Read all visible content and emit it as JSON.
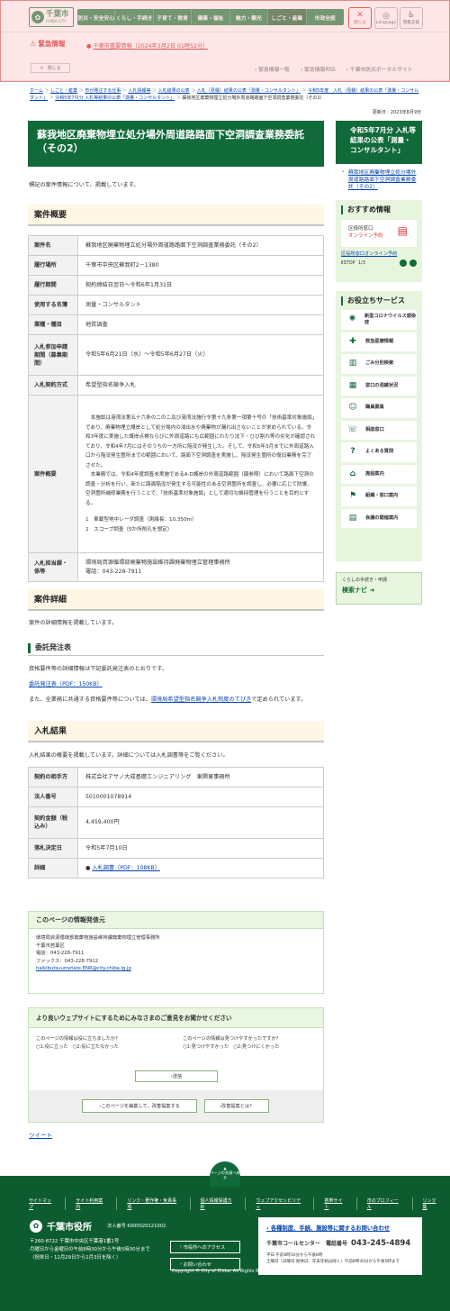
{
  "header": {
    "logo_title": "千葉市",
    "logo_sub": "CHIBA CITY",
    "nav": [
      "防災・安全安心",
      "くらし・手続き",
      "子育て・教育",
      "健康・福祉",
      "魅力・観光",
      "しごと・産業",
      "市政全般"
    ],
    "close_label": "閉じる",
    "language_label": "Language",
    "support_label": "閲覧支援"
  },
  "emergency": {
    "label": "緊急情報",
    "close_label": "閉じる",
    "news": "千葉市重要情報（2024年3月2日 01時52分）",
    "links": [
      "緊急情報一覧",
      "緊急情報RSS",
      "千葉市防災ポータルサイト"
    ]
  },
  "breadcrumb": [
    "ホーム",
    "しごと・産業",
    "市が発注する仕事",
    "入札情報等",
    "入札結果の公表",
    "入札（見積）結果の公表「測量・コンサルタント」",
    "令和5年度　入札（見積）結果の公表「測量・コンサルタント」",
    "令和5年7月分 入札等結果の公表「測量・コンサルタント」",
    "蘇我地区廃棄物埋立処分場外周道路路面下空洞調査業務委託（その2）"
  ],
  "updated": "更新日：2023年8月9日",
  "page_title": "蘇我地区廃棄物埋立処分場外周道路路面下空洞調査業務委託（その2）",
  "intro": "標記の案件情報について、掲載しています。",
  "overview": {
    "heading": "案件概要",
    "rows": [
      {
        "h": "案件名",
        "v": "蘇我地区廃棄物埋立処分場外周道路路面下空洞調査業務委託（その2）"
      },
      {
        "h": "履行場所",
        "v": "千葉市中央区蘇我町2－1380"
      },
      {
        "h": "履行期間",
        "v": "契約締結日翌日～令和6年1月31日"
      },
      {
        "h": "使用する名簿",
        "v": "測量・コンサルタント"
      },
      {
        "h": "業種・種目",
        "v": "地質調査"
      },
      {
        "h": "入札参加申請期間（募集期間）",
        "v": "令和5年6月21日（水）～令和5年6月27日（火）"
      },
      {
        "h": "入札契約方式",
        "v": "希望型指名競争入札"
      }
    ],
    "summary_head": "案件概要",
    "summary_p1": "　本施設は港湾法第五十六条のニのニ及び港湾法施行令第十九条第一項第十号の「技術基準対象施設」であり、廃棄物埋立護岸として処分場内の浸出水や廃棄物が漏れ出さないことが求められている。令和3年度に実施した護岸点検ならびに外周道路にも広範囲にわたり沈下・ひび割れ等の劣化が確認されており、令和4年7月にはそのうちの一方所に陥没が発生した。そして、令和5年3月までに外周道路入口から陥没発生箇所までの範囲において、路面下空洞調査を実施し、陥没発生箇所の復旧業務を完了させた。",
    "summary_p2": "　本業務では、令和4年度調査未実施であるA-D護岸の外周道路範囲（図参照）において路面下空洞の調査・分析を行い、新たに路面陥没が発生する可能性のある空洞箇所を調査し、必要に応じて防護、空洞箇所補修業務を行うことで、「技術基準対象施設」として適切な維持管理を行うことを目的とする。",
    "summary_l1": "1　車載型地中レーダ調査（測線長：10,350m）",
    "summary_l2": "2　スコープ調査（5か所削孔を想定）",
    "dept_head": "入札担当課・係等",
    "dept_v1": "環境局資源循環部廃棄物施設維持課廃棄物埋立管理事務所",
    "dept_v2": "電話：043-228-7911"
  },
  "details": {
    "heading": "案件詳細",
    "text": "案件の詳細情報を掲載しています。",
    "sub_heading": "委託発注表",
    "p1": "資格要件等の詳細情報は下記委託発注表のとおりです。",
    "link1": "委託発注表（PDF：150KB）",
    "p2a": "また、全業務に共通する資格要件等については、",
    "p2link": "環境局希望型指名競争入札制度のてびき",
    "p2b": "で定められています。"
  },
  "results": {
    "heading": "入札結果",
    "text": "入札結果の概要を掲載しています。詳細については入札調書等をご覧ください。",
    "rows": [
      {
        "h": "契約の相手方",
        "v": "株式会社アサノ大成基礎エンジニアリング　東関東事務所"
      },
      {
        "h": "法人番号",
        "v": "5010001078914"
      },
      {
        "h": "契約金額（税込み）",
        "v": "4,459,400円"
      },
      {
        "h": "落札決定日",
        "v": "令和5年7月10日"
      }
    ],
    "detail_head": "詳細",
    "detail_link": "入札調書（PDF：108KB）"
  },
  "info": {
    "heading": "このページの情報発信元",
    "lines": [
      "環境局資源循環部廃棄物施設維持課廃棄物埋立管理事務所",
      "千葉市若葉区",
      "電話：043-228-7911",
      "ファックス：043-228-7912"
    ],
    "email": "haikibutsuumetate.ENR@city.chiba.lg.jp"
  },
  "feedback": {
    "heading": "より良いウェブサイトにするためにみなさまのご意見をお聞かせください",
    "q1": "このページの情報は役に立ちましたか？",
    "q1a": "1:役に立った",
    "q1b": "2:役に立たなかった",
    "q2": "このページの情報は見つけやすかったですか？",
    "q2a": "1:見つけやすかった",
    "q2b": "2:見つけにくかった",
    "send": "送信",
    "btn1": "このページを編集して、改善提案する",
    "btn2": "改善提案とは？"
  },
  "tweet": "ツイート",
  "sidebar": {
    "month_title": "令和5年7月分 入札等結果の公表「測量・コンサルタント」",
    "month_link": "蘇我地区廃棄物埋立処分場外周道路路面下空洞調査業務委託（その2）",
    "recommend": "おすすめ情報",
    "card_l1": "区役所窓口",
    "card_l2": "オンライン予約",
    "card_caption": "区役所窓口オンライン予約",
    "stop": "STOP",
    "count": "1/3",
    "useful": "お役立ちサービス",
    "services": [
      "新型コロナウイルス感染症",
      "救急医療情報",
      "ごみ分別検索",
      "窓口の混雑状況",
      "職員募集",
      "相談窓口",
      "よくある質問",
      "施設案内",
      "組織・窓口案内",
      "会議の開催案内"
    ],
    "navi_a": "くらしの手続き・申請",
    "navi_b": "検索ナビ"
  },
  "footer": {
    "pagetop": "ページの先頭へ戻る",
    "links": [
      "サイトマップ",
      "サイト利用案内",
      "リンク・著作権・免責事項",
      "個人情報保護方針",
      "ウェブアクセシビリティ",
      "携帯サイト",
      "市のプロフィール",
      "リンク集"
    ],
    "name": "千葉市役所",
    "corp": "法人番号 6000020121002",
    "addr1": "〒260-8722 千葉市中央区千葉港1番1号",
    "addr2": "月曜日から金曜日の午前8時30分から午後5時30分まで",
    "addr3": "（祝休日・12月29日から1月3日を除く）",
    "access": "市役所へのアクセス",
    "contact": "お問い合わせ",
    "call_title": "各種制度、手続、施設等に関するお問い合わせ",
    "call_center": "千葉市コールセンター",
    "call_label": "電話番号",
    "call_number": "043-245-4894",
    "call_hours1": "平日 午前8時30分から午後8時",
    "call_hours2": "土曜日（日曜日 祝休日、年末年始は除く）午前8時30分から午後5時まで",
    "copyright": "Copyright © City of Chiba. All Rights Reserved."
  }
}
